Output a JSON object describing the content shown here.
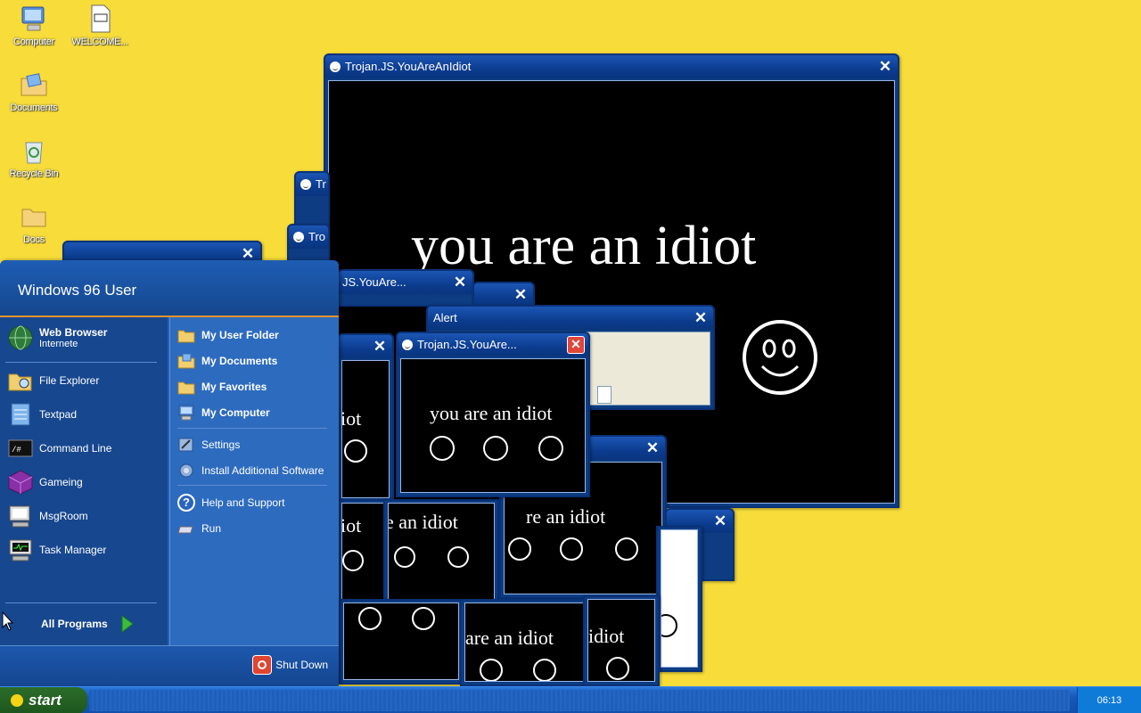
{
  "desktop": {
    "icons": [
      {
        "label": "Computer",
        "icon": "computer-icon"
      },
      {
        "label": "WELCOME...",
        "icon": "markdown-file-icon",
        "badge": "M↓"
      },
      {
        "label": "Documents",
        "icon": "documents-folder-icon"
      },
      {
        "label": "Recycle Bin",
        "icon": "recycle-bin-icon"
      },
      {
        "label": "Docs",
        "icon": "folder-icon"
      }
    ]
  },
  "windows": {
    "main": {
      "title": "Trojan.JS.YouAreAnIdiot",
      "text": "you are an idiot"
    },
    "behind_1": {
      "title": "Tr"
    },
    "behind_2": {
      "title": "Tro"
    },
    "partial_1": {
      "title": "JS.YouAre..."
    },
    "alert": {
      "title": "Alert"
    },
    "front": {
      "title": "Trojan.JS.YouAre...",
      "text": "you are an idiot"
    },
    "stack_text_1": "iot",
    "stack_text_2": "iot",
    "stack_text_3": "e an idiot",
    "stack_text_4": "re an idiot",
    "stack_text_5": "are an idiot",
    "stack_text_6": "idiot"
  },
  "start_menu": {
    "user": "Windows 96 User",
    "left_items": [
      {
        "label": "Web Browser",
        "sub": "Internete",
        "icon": "globe-icon"
      },
      {
        "label": "File Explorer",
        "icon": "file-explorer-icon"
      },
      {
        "label": "Textpad",
        "icon": "notepad-icon"
      },
      {
        "label": "Command Line",
        "icon": "terminal-icon",
        "glyph": "/#"
      },
      {
        "label": "Gameing",
        "icon": "game-cube-icon"
      },
      {
        "label": "MsgRoom",
        "icon": "msgroom-icon"
      },
      {
        "label": "Task Manager",
        "icon": "task-manager-icon"
      }
    ],
    "all_programs": "All Programs",
    "right_items": [
      {
        "label": "My User Folder",
        "icon": "folder-icon"
      },
      {
        "label": "My Documents",
        "icon": "documents-folder-icon"
      },
      {
        "label": "My Favorites",
        "icon": "folder-icon"
      },
      {
        "label": "My Computer",
        "icon": "computer-icon"
      },
      {
        "label": "Settings",
        "icon": "settings-icon"
      },
      {
        "label": "Install Additional Software",
        "icon": "install-icon"
      },
      {
        "label": "Help and Support",
        "icon": "help-icon",
        "glyph": "?"
      },
      {
        "label": "Run",
        "icon": "run-icon"
      }
    ],
    "shutdown": "Shut Down"
  },
  "taskbar": {
    "start_label": "start",
    "clock": "06:13"
  },
  "colors": {
    "desktop": "#f7dc3a",
    "titlebar": "#0c3c8f",
    "start_button": "#245f23"
  }
}
